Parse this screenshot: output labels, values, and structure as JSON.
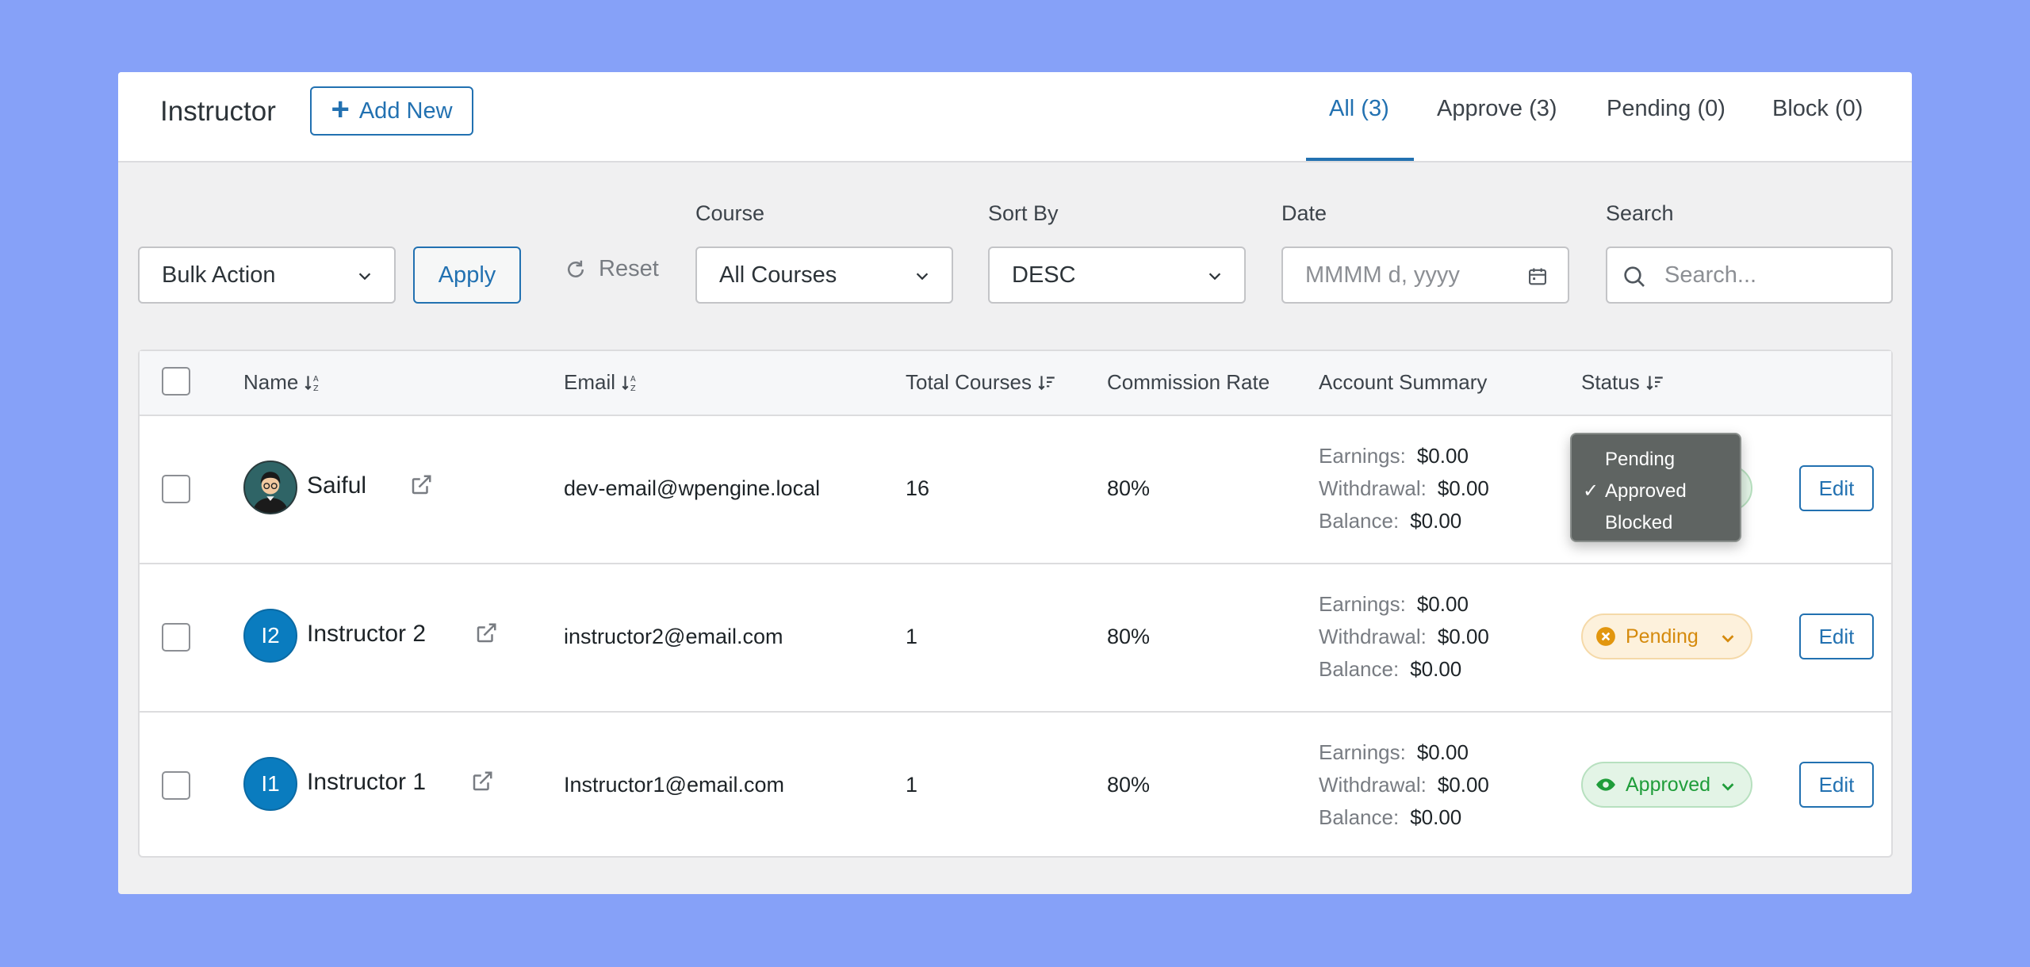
{
  "header": {
    "title": "Instructor",
    "add_new_label": "Add New",
    "tabs": [
      {
        "label": "All (3)",
        "active": true
      },
      {
        "label": "Approve (3)",
        "active": false
      },
      {
        "label": "Pending (0)",
        "active": false
      },
      {
        "label": "Block (0)",
        "active": false
      }
    ]
  },
  "filters": {
    "bulk_action": "Bulk Action",
    "apply_label": "Apply",
    "reset_label": "Reset",
    "course_label": "Course",
    "course_value": "All Courses",
    "sort_label": "Sort By",
    "sort_value": "DESC",
    "date_label": "Date",
    "date_placeholder": "MMMM d, yyyy",
    "search_label": "Search",
    "search_placeholder": "Search..."
  },
  "table": {
    "columns": [
      "Name",
      "Email",
      "Total Courses",
      "Commission Rate",
      "Account Summary",
      "Status"
    ],
    "summary_labels": {
      "earnings": "Earnings:",
      "withdrawal": "Withdrawal:",
      "balance": "Balance:"
    },
    "edit_label": "Edit",
    "rows": [
      {
        "name": "Saiful",
        "avatar": "photo",
        "email": "dev-email@wpengine.local",
        "courses": "16",
        "commission": "80%",
        "earnings": "$0.00",
        "withdrawal": "$0.00",
        "balance": "$0.00",
        "status": "Approved"
      },
      {
        "name": "Instructor 2",
        "avatar": "I2",
        "email": "instructor2@email.com",
        "courses": "1",
        "commission": "80%",
        "earnings": "$0.00",
        "withdrawal": "$0.00",
        "balance": "$0.00",
        "status": "Pending"
      },
      {
        "name": "Instructor 1",
        "avatar": "I1",
        "email": "Instructor1@email.com",
        "courses": "1",
        "commission": "80%",
        "earnings": "$0.00",
        "withdrawal": "$0.00",
        "balance": "$0.00",
        "status": "Approved"
      }
    ]
  },
  "status_dropdown": {
    "options": [
      "Pending",
      "Approved",
      "Blocked"
    ],
    "selected": "Approved"
  },
  "colors": {
    "accent": "#2271b1",
    "pending": "#d58a0c",
    "approved": "#1f9d3a",
    "background": "#86a1f8"
  }
}
